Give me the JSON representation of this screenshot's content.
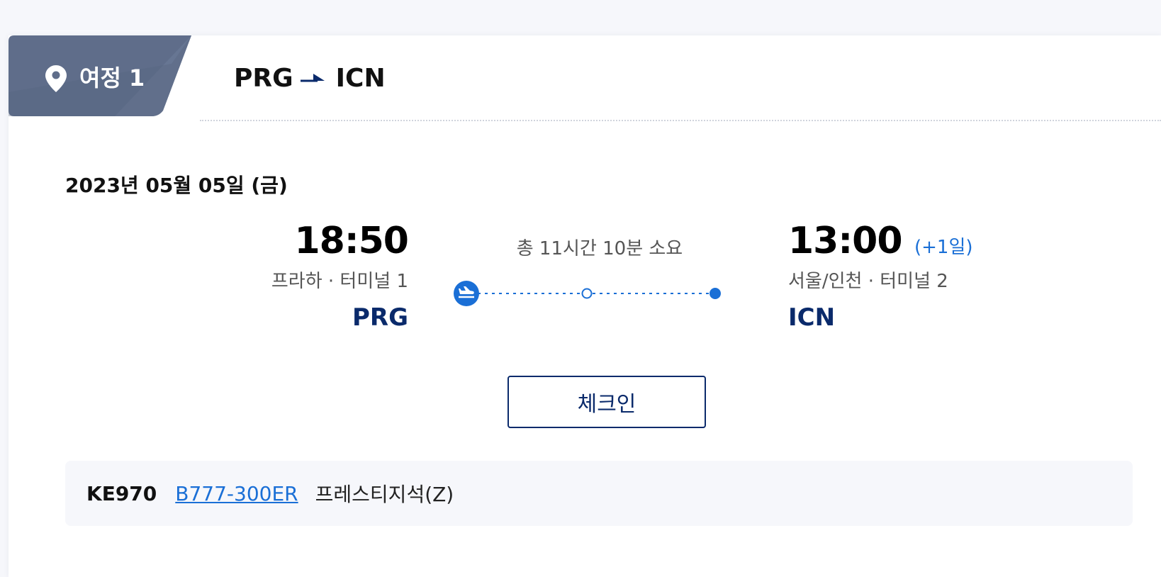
{
  "itinerary": {
    "tab_label": "여정 1",
    "origin": "PRG",
    "destination": "ICN"
  },
  "flight": {
    "date": "2023년 05월 05일 (금)",
    "departure": {
      "time": "18:50",
      "city_terminal": "프라하 · 터미널 1",
      "code": "PRG"
    },
    "duration": "총 11시간 10분 소요",
    "arrival": {
      "time": "13:00",
      "day_offset": "(+1일)",
      "city_terminal": "서울/인천 · 터미널 2",
      "code": "ICN"
    },
    "checkin_label": "체크인",
    "flight_number": "KE970",
    "aircraft": "B777-300ER",
    "cabin": "프레스티지석(Z)"
  },
  "icons": {
    "tab": "location-pin-icon",
    "route": "plane-arrow-icon",
    "departure": "takeoff-icon",
    "stopover": "stop-circle-icon",
    "arrival": "arrival-dot-icon"
  },
  "colors": {
    "tab_bg": "#5f6d8a",
    "navy": "#0a2a6b",
    "accent_blue": "#1a6fd6",
    "panel_bg": "#f6f7fb"
  }
}
